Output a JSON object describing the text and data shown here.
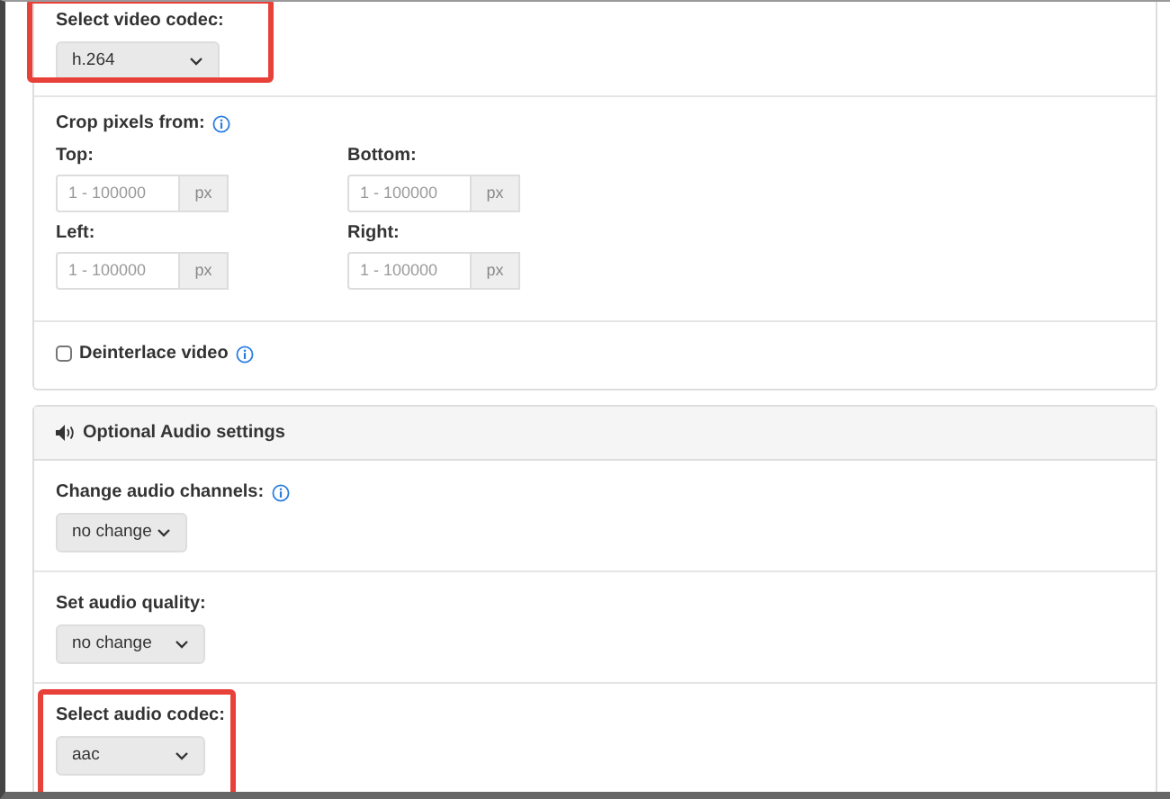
{
  "video_settings": {
    "sections": [
      {
        "kind": "select",
        "label": "Select video codec:",
        "value": "h.264",
        "info": false,
        "highlighted": true
      },
      {
        "kind": "crop",
        "label": "Crop pixels from:",
        "info": true,
        "highlighted": false,
        "fields": [
          {
            "label": "Top:",
            "placeholder": "1 - 100000",
            "unit": "px"
          },
          {
            "label": "Bottom:",
            "placeholder": "1 - 100000",
            "unit": "px"
          },
          {
            "label": "Left:",
            "placeholder": "1 - 100000",
            "unit": "px"
          },
          {
            "label": "Right:",
            "placeholder": "1 - 100000",
            "unit": "px"
          }
        ]
      },
      {
        "kind": "checkbox",
        "label": "Deinterlace video",
        "checked": false,
        "info": true,
        "highlighted": false
      }
    ]
  },
  "audio_settings": {
    "title": "Optional Audio settings",
    "sections": [
      {
        "kind": "select",
        "label": "Change audio channels:",
        "value": "no change",
        "info": true,
        "highlighted": false
      },
      {
        "kind": "select",
        "label": "Set audio quality:",
        "value": "no change",
        "info": false,
        "highlighted": false
      },
      {
        "kind": "select",
        "label": "Select audio codec:",
        "value": "aac",
        "info": false,
        "highlighted": true
      }
    ]
  }
}
